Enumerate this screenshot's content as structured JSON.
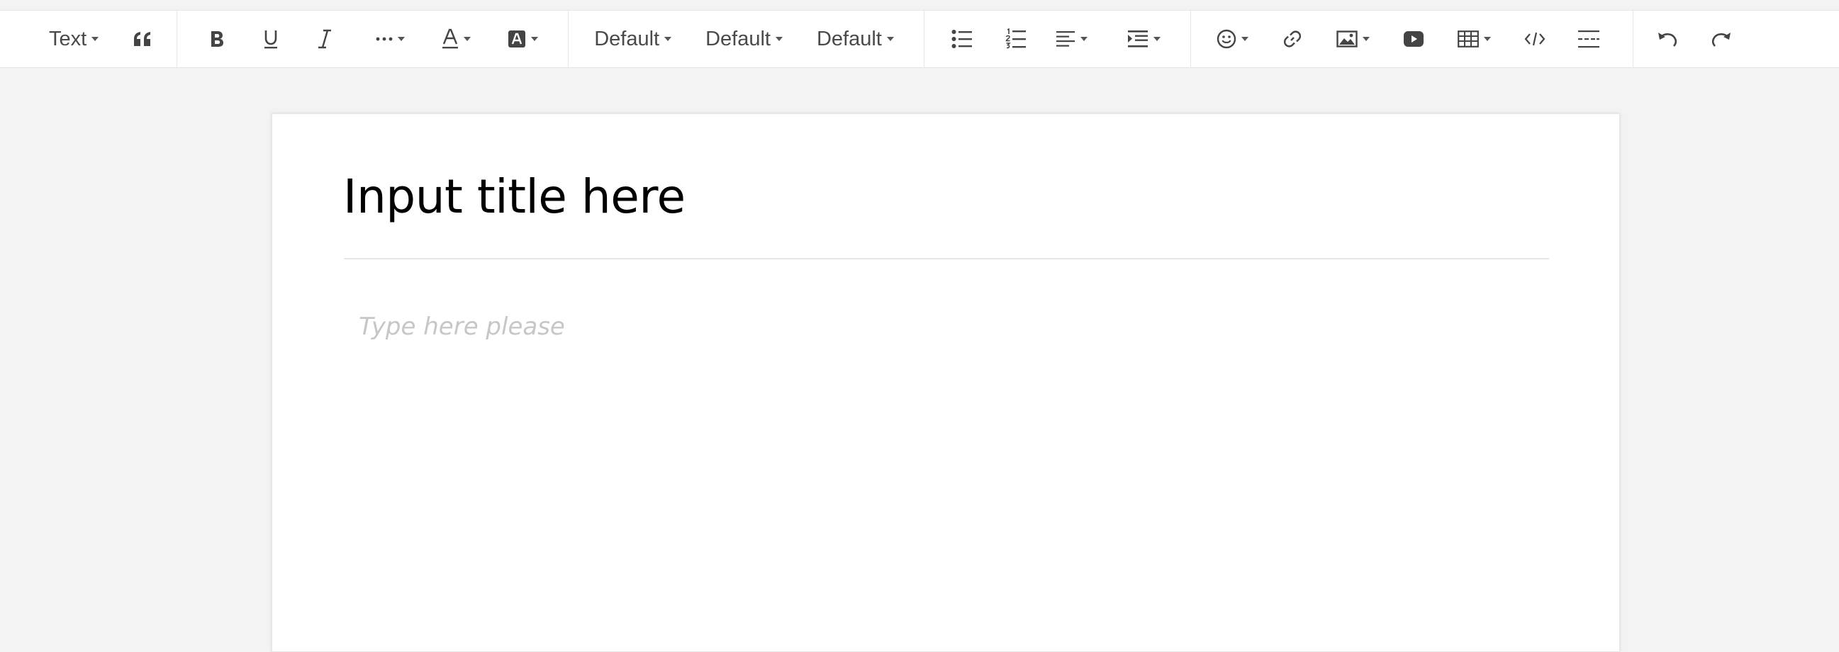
{
  "toolbar": {
    "block_type": "Text",
    "font_family": "Default",
    "font_size": "Default",
    "line_height": "Default"
  },
  "editor": {
    "title_placeholder": "Input title here",
    "body_placeholder": "Type here please"
  },
  "icons": [
    "quote-icon",
    "bold-icon",
    "underline-icon",
    "italic-icon",
    "more-styles-icon",
    "font-color-icon",
    "background-color-icon",
    "bullet-list-icon",
    "numbered-list-icon",
    "text-align-icon",
    "indent-icon",
    "emoji-icon",
    "link-icon",
    "image-icon",
    "video-icon",
    "table-icon",
    "code-icon",
    "horizontal-rule-icon",
    "undo-icon",
    "redo-icon"
  ]
}
